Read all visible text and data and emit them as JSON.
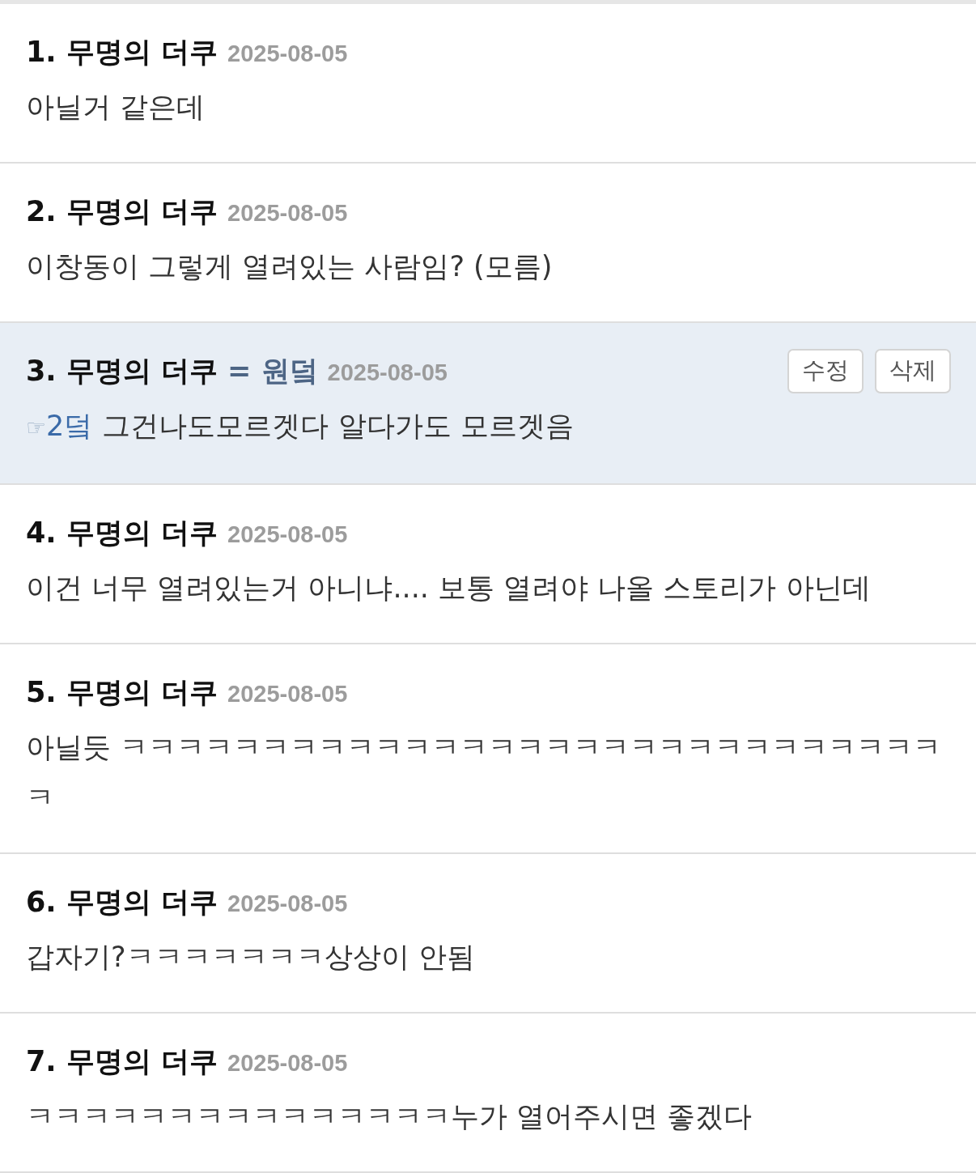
{
  "comments": [
    {
      "heading": "1. 무명의 더쿠",
      "date": "2025-08-05",
      "text": "아닐거 같은데",
      "highlighted": false
    },
    {
      "heading": "2. 무명의 더쿠",
      "date": "2025-08-05",
      "text": "이창동이 그렇게 열려있는 사람임? (모름)",
      "highlighted": false
    },
    {
      "heading": "3. 무명의 더쿠",
      "author_tag": "= 원덬",
      "date": "2025-08-05",
      "highlighted": true,
      "actions": [
        "수정",
        "삭제"
      ],
      "reply_to": {
        "marker": "☞",
        "label": "2덬"
      },
      "text": "그건나도모르겟다 알다가도 모르겟음"
    },
    {
      "heading": "4. 무명의 더쿠",
      "date": "2025-08-05",
      "text": "이건 너무 열려있는거 아니냐.... 보통 열려야 나올 스토리가 아닌데",
      "highlighted": false
    },
    {
      "heading": "5. 무명의 더쿠",
      "date": "2025-08-05",
      "text": "아닐듯 ㅋㅋㅋㅋㅋㅋㅋㅋㅋㅋㅋㅋㅋㅋㅋㅋㅋㅋㅋㅋㅋㅋㅋㅋㅋㅋㅋㅋㅋㅋ",
      "highlighted": false
    },
    {
      "heading": "6. 무명의 더쿠",
      "date": "2025-08-05",
      "text": "갑자기?ㅋㅋㅋㅋㅋㅋㅋ상상이 안됨",
      "highlighted": false
    },
    {
      "heading": "7. 무명의 더쿠",
      "date": "2025-08-05",
      "text": "ㅋㅋㅋㅋㅋㅋㅋㅋㅋㅋㅋㅋㅋㅋㅋ누가 열어주시면 좋겠다",
      "highlighted": false
    }
  ]
}
